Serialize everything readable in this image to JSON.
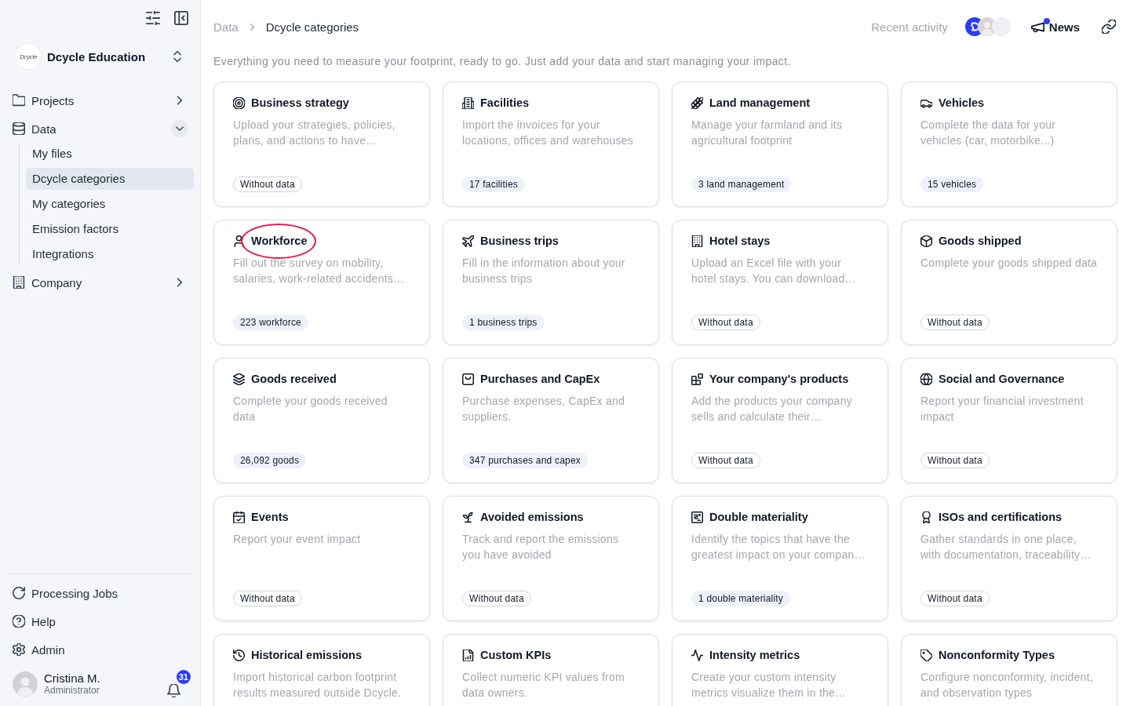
{
  "sidebar": {
    "organization": {
      "logo_text": "Dcycle",
      "name": "Dcycle Education"
    },
    "nav": [
      {
        "label": "Projects",
        "expanded": false
      },
      {
        "label": "Data",
        "expanded": true,
        "children": [
          {
            "label": "My files",
            "selected": false
          },
          {
            "label": "Dcycle categories",
            "selected": true
          },
          {
            "label": "My categories",
            "selected": false
          },
          {
            "label": "Emission factors",
            "selected": false
          },
          {
            "label": "Integrations",
            "selected": false
          }
        ]
      },
      {
        "label": "Company",
        "expanded": false
      }
    ],
    "footer": [
      "Processing Jobs",
      "Help",
      "Admin"
    ],
    "user": {
      "name": "Cristina M.",
      "role": "Administrator",
      "notifications": "31"
    }
  },
  "header": {
    "breadcrumb": [
      "Data",
      "Dcycle categories"
    ],
    "recent_activity": "Recent activity",
    "news": {
      "label": "News",
      "unread": true
    }
  },
  "intro": "Everything you need to measure your footprint, ready to go. Just add your data and start managing your impact.",
  "cards": [
    {
      "title": "Business strategy",
      "description": "Upload your strategies, policies, plans, and actions to have…",
      "badge": "Without data",
      "has_data": false,
      "highlighted": false
    },
    {
      "title": "Facilities",
      "description": "Import the invoices for your locations, offices and warehouses",
      "badge": "17 facilities",
      "has_data": true,
      "highlighted": false
    },
    {
      "title": "Land management",
      "description": "Manage your farmland and its agricultural footprint",
      "badge": "3 land management",
      "has_data": true,
      "highlighted": false
    },
    {
      "title": "Vehicles",
      "description": "Complete the data for your vehicles (car, motorbike...)",
      "badge": "15 vehicles",
      "has_data": true,
      "highlighted": false
    },
    {
      "title": "Workforce",
      "description": "Fill out the survey on mobility, salaries, work-related accidents…",
      "badge": "223 workforce",
      "has_data": true,
      "highlighted": true
    },
    {
      "title": "Business trips",
      "description": "Fill in the information about your business trips",
      "badge": "1 business trips",
      "has_data": true,
      "highlighted": false
    },
    {
      "title": "Hotel stays",
      "description": "Upload an Excel file with your hotel stays. You can download…",
      "badge": "Without data",
      "has_data": false,
      "highlighted": false
    },
    {
      "title": "Goods shipped",
      "description": "Complete your goods shipped data",
      "badge": "Without data",
      "has_data": false,
      "highlighted": false
    },
    {
      "title": "Goods received",
      "description": "Complete your goods received data",
      "badge": "26,092 goods",
      "has_data": true,
      "highlighted": false
    },
    {
      "title": "Purchases and CapEx",
      "description": "Purchase expenses, CapEx and suppliers.",
      "badge": "347 purchases and capex",
      "has_data": true,
      "highlighted": false
    },
    {
      "title": "Your company's products",
      "description": "Add the products your company sells and calculate their…",
      "badge": "Without data",
      "has_data": false,
      "highlighted": false
    },
    {
      "title": "Social and Governance",
      "description": "Report your financial investment impact",
      "badge": "Without data",
      "has_data": false,
      "highlighted": false
    },
    {
      "title": "Events",
      "description": "Report your event impact",
      "badge": "Without data",
      "has_data": false,
      "highlighted": false
    },
    {
      "title": "Avoided emissions",
      "description": "Track and report the emissions you have avoided",
      "badge": "Without data",
      "has_data": false,
      "highlighted": false
    },
    {
      "title": "Double materiality",
      "description": "Identify the topics that have the greatest impact on your compan…",
      "badge": "1 double materiality",
      "has_data": true,
      "highlighted": false
    },
    {
      "title": "ISOs and certifications",
      "description": "Gather standards in one place, with documentation, traceability…",
      "badge": "Without data",
      "has_data": false,
      "highlighted": false
    },
    {
      "title": "Historical emissions",
      "description": "Import historical carbon footprint results measured outside Dcycle.",
      "highlighted": false
    },
    {
      "title": "Custom KPIs",
      "description": "Collect numeric KPI values from data owners.",
      "highlighted": false
    },
    {
      "title": "Intensity metrics",
      "description": "Create your custom intensity metrics visualize them in the…",
      "highlighted": false
    },
    {
      "title": "Nonconformity Types",
      "description": "Configure nonconformity, incident, and observation types",
      "highlighted": false
    }
  ]
}
